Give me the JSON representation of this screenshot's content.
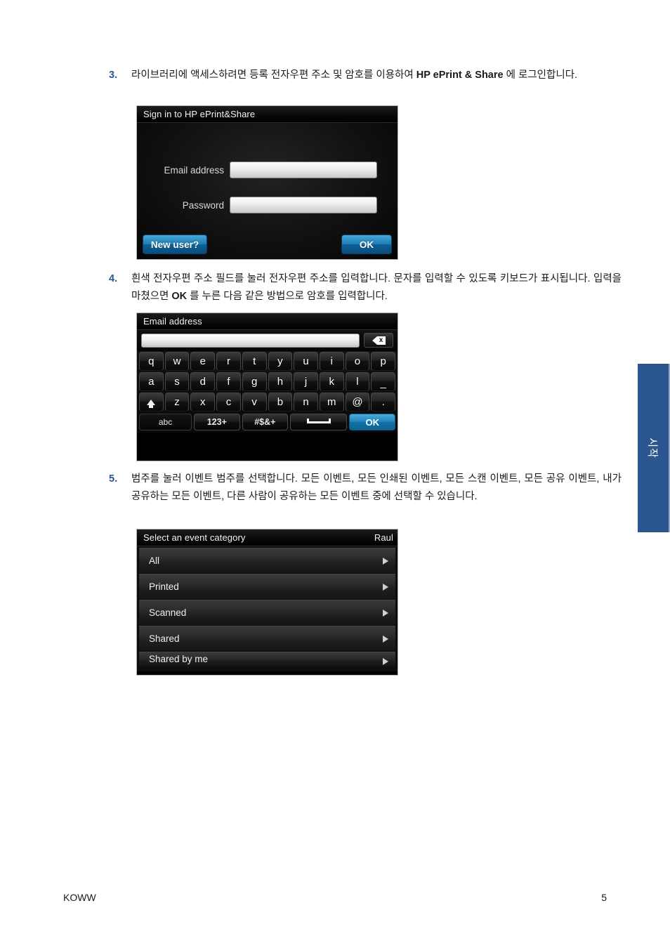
{
  "document": {
    "footer_left": "KOWW",
    "footer_page": "5",
    "side_tab_label": "시작"
  },
  "steps": [
    {
      "number": "3.",
      "text_prefix": "라이브러리에 액세스하려면 등록 전자우편 주소 및 암호를 이용하여 ",
      "bold": "HP ePrint & Share",
      "text_suffix": " 에 로그인합니다."
    },
    {
      "number": "4.",
      "text_prefix": "흰색 전자우편 주소 필드를 눌러 전자우편 주소를 입력합니다. 문자를 입력할 수 있도록 키보드가 표시됩니다. 입력을 마쳤으면 ",
      "bold": "OK",
      "text_suffix": " 를 누른 다음 같은 방법으로 암호를 입력합니다."
    },
    {
      "number": "5.",
      "text_prefix": "범주를 눌러 이벤트 범주를 선택합니다. 모든 이벤트, 모든 인쇄된 이벤트, 모든 스캔 이벤트, 모든 공유 이벤트, 내가 공유하는 모든 이벤트, 다른 사람이 공유하는 모든 이벤트 중에 선택할 수 있습니다.",
      "bold": "",
      "text_suffix": ""
    }
  ],
  "signin_screen": {
    "title": "Sign in to HP ePrint&Share",
    "email_label": "Email address",
    "email_value": "",
    "password_label": "Password",
    "password_value": "",
    "new_user_button": "New user?",
    "ok_button": "OK"
  },
  "keyboard_screen": {
    "title": "Email address",
    "input_value": "",
    "backspace_label": "x",
    "rows": [
      [
        "q",
        "w",
        "e",
        "r",
        "t",
        "y",
        "u",
        "i",
        "o",
        "p"
      ],
      [
        "a",
        "s",
        "d",
        "f",
        "g",
        "h",
        "j",
        "k",
        "l",
        "_"
      ],
      [
        "z",
        "x",
        "c",
        "v",
        "b",
        "n",
        "m",
        "@",
        "."
      ]
    ],
    "shift_key": "shift",
    "bottom_row": {
      "abc": "abc",
      "numbers": "123+",
      "symbols": "#$&+",
      "space": "",
      "ok": "OK"
    }
  },
  "event_category_screen": {
    "title": "Select an event category",
    "user": "Raul",
    "items": [
      {
        "label": "All"
      },
      {
        "label": "Printed"
      },
      {
        "label": "Scanned"
      },
      {
        "label": "Shared"
      },
      {
        "label": "Shared by me"
      }
    ]
  },
  "colors": {
    "accent_blue": "#2b5690",
    "lcd_button_blue": "#1d7cb5"
  }
}
